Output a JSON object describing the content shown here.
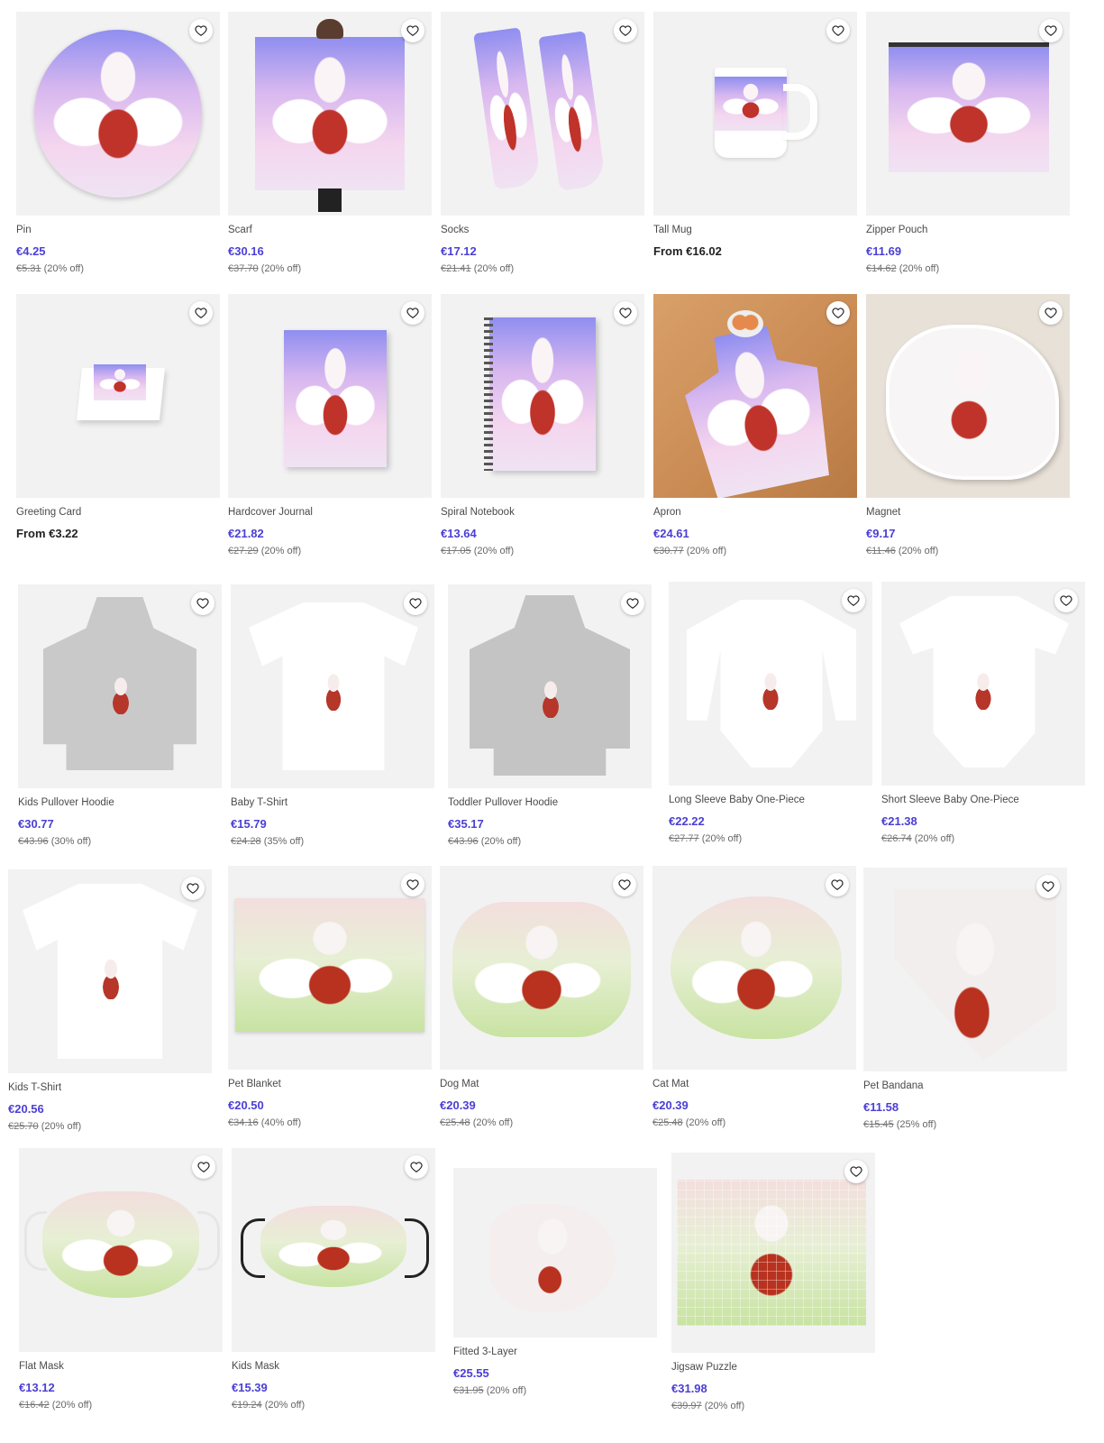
{
  "products": [
    {
      "title": "Pin",
      "price": "€4.25",
      "original": "€5.31",
      "discount": "(20% off)"
    },
    {
      "title": "Scarf",
      "price": "€30.16",
      "original": "€37.70",
      "discount": "(20% off)"
    },
    {
      "title": "Socks",
      "price": "€17.12",
      "original": "€21.41",
      "discount": "(20% off)"
    },
    {
      "title": "Tall Mug",
      "price": "From €16.02",
      "original": "",
      "discount": ""
    },
    {
      "title": "Zipper Pouch",
      "price": "€11.69",
      "original": "€14.62",
      "discount": "(20% off)"
    },
    {
      "title": "Greeting Card",
      "price": "From €3.22",
      "original": "",
      "discount": ""
    },
    {
      "title": "Hardcover Journal",
      "price": "€21.82",
      "original": "€27.29",
      "discount": "(20% off)"
    },
    {
      "title": "Spiral Notebook",
      "price": "€13.64",
      "original": "€17.05",
      "discount": "(20% off)"
    },
    {
      "title": "Apron",
      "price": "€24.61",
      "original": "€30.77",
      "discount": "(20% off)"
    },
    {
      "title": "Magnet",
      "price": "€9.17",
      "original": "€11.46",
      "discount": "(20% off)"
    },
    {
      "title": "Kids Pullover Hoodie",
      "price": "€30.77",
      "original": "€43.96",
      "discount": "(30% off)"
    },
    {
      "title": "Baby T-Shirt",
      "price": "€15.79",
      "original": "€24.28",
      "discount": "(35% off)"
    },
    {
      "title": "Toddler Pullover Hoodie",
      "price": "€35.17",
      "original": "€43.96",
      "discount": "(20% off)"
    },
    {
      "title": "Long Sleeve Baby One-Piece",
      "price": "€22.22",
      "original": "€27.77",
      "discount": "(20% off)"
    },
    {
      "title": "Short Sleeve Baby One-Piece",
      "price": "€21.38",
      "original": "€26.74",
      "discount": "(20% off)"
    },
    {
      "title": "Kids T-Shirt",
      "price": "€20.56",
      "original": "€25.70",
      "discount": "(20% off)"
    },
    {
      "title": "Pet Blanket",
      "price": "€20.50",
      "original": "€34.16",
      "discount": "(40% off)"
    },
    {
      "title": "Dog Mat",
      "price": "€20.39",
      "original": "€25.48",
      "discount": "(20% off)"
    },
    {
      "title": "Cat Mat",
      "price": "€20.39",
      "original": "€25.48",
      "discount": "(20% off)"
    },
    {
      "title": "Pet Bandana",
      "price": "€11.58",
      "original": "€15.45",
      "discount": "(25% off)"
    },
    {
      "title": "Flat Mask",
      "price": "€13.12",
      "original": "€16.42",
      "discount": "(20% off)"
    },
    {
      "title": "Kids Mask",
      "price": "€15.39",
      "original": "€19.24",
      "discount": "(20% off)"
    },
    {
      "title": "Fitted 3-Layer",
      "price": "€25.55",
      "original": "€31.95",
      "discount": "(20% off)"
    },
    {
      "title": "Jigsaw Puzzle",
      "price": "€31.98",
      "original": "€39.97",
      "discount": "(20% off)"
    }
  ],
  "icons": {
    "favorite": "heart-outline-icon"
  },
  "colors": {
    "price": "#4b3fd4",
    "background": "#ffffff",
    "thumb_bg": "#f2f2f2"
  }
}
